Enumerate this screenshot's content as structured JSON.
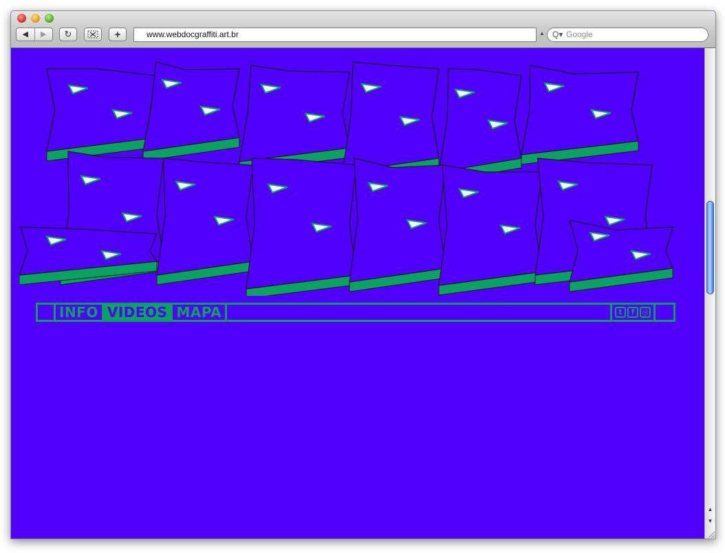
{
  "browser": {
    "url": "www.webdocgraffiti.art.br",
    "search_placeholder": "Google",
    "back_glyph": "◀",
    "forward_glyph": "▶",
    "reload_glyph": "↻",
    "add_glyph": "+",
    "search_glyph": "Q▾"
  },
  "page": {
    "background_color": "#5000fa",
    "accent_color": "#08a35e",
    "nav": [
      {
        "label": "INFO",
        "active": false
      },
      {
        "label": "VIDEOS",
        "active": true
      },
      {
        "label": "MAPA",
        "active": false
      }
    ],
    "social": [
      {
        "icon": "twitter-icon",
        "glyph": "t"
      },
      {
        "icon": "facebook-icon",
        "glyph": "f"
      },
      {
        "icon": "instagram-icon",
        "glyph": "◎"
      }
    ]
  }
}
